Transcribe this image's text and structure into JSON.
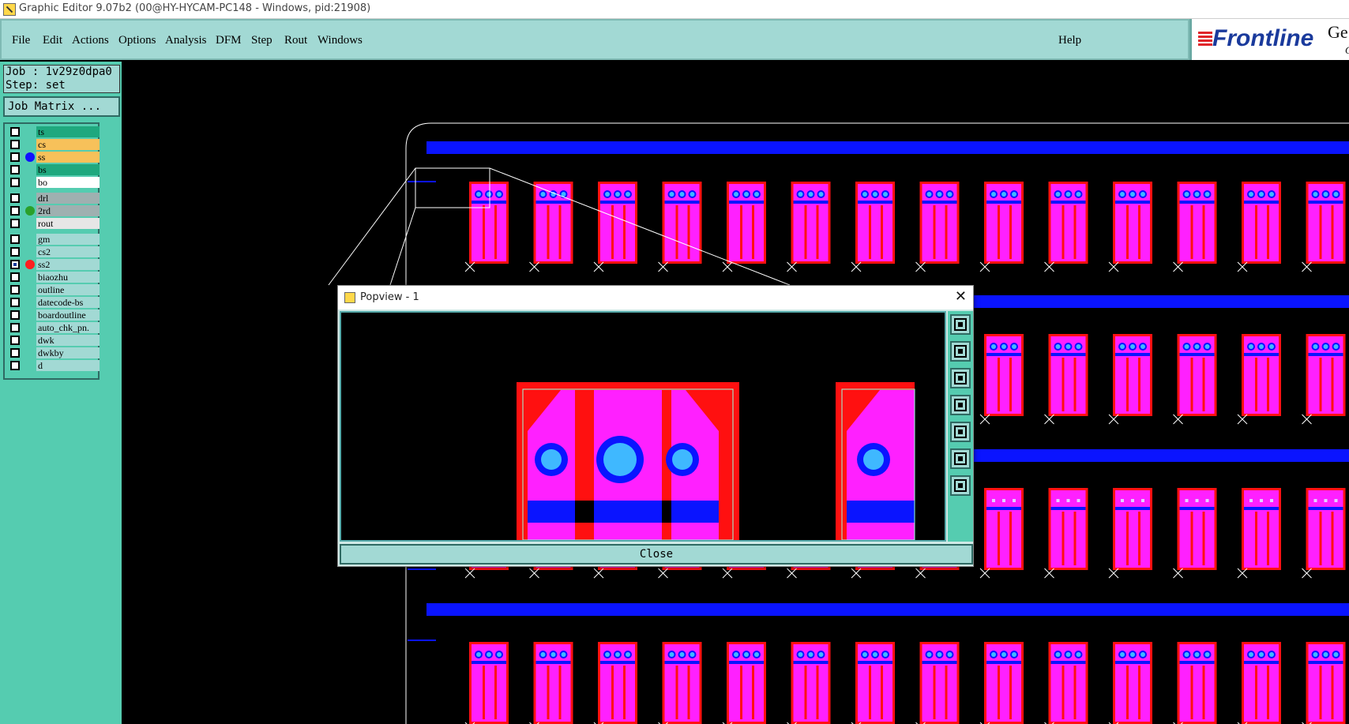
{
  "window": {
    "title": "Graphic Editor 9.07b2 (00@HY-HYCAM-PC148 - Windows, pid:21908)"
  },
  "menu": {
    "file": "File",
    "edit": "Edit",
    "actions": "Actions",
    "options": "Options",
    "analysis": "Analysis",
    "dfm": "DFM",
    "step": "Step",
    "rout": "Rout",
    "windows": "Windows",
    "help": "Help"
  },
  "logo": {
    "brand": "Frontline",
    "tail": "Ge",
    "tail2": "G"
  },
  "job": {
    "job_line": "Job : 1v29z0dpa0",
    "step_line": "Step: set"
  },
  "job_matrix_button": "Job Matrix ...",
  "layers": [
    {
      "name": "ts",
      "color": "#1fa87e",
      "checked": false,
      "dot": ""
    },
    {
      "name": "cs",
      "color": "#f7c15a",
      "checked": false,
      "dot": ""
    },
    {
      "name": "ss",
      "color": "#f7c15a",
      "checked": false,
      "dot": "#1010ff"
    },
    {
      "name": "bs",
      "color": "#1fa87e",
      "checked": false,
      "dot": ""
    },
    {
      "name": "bo",
      "color": "#ffffff",
      "checked": false,
      "dot": ""
    },
    {
      "name": "drl",
      "color": "#9fb0b0",
      "checked": false,
      "dot": ""
    },
    {
      "name": "2rd",
      "color": "#9fb0b0",
      "checked": false,
      "dot": "#2aa02a"
    },
    {
      "name": "rout",
      "color": "#e6e6e6",
      "checked": false,
      "dot": ""
    },
    {
      "name": "gm",
      "color": "#a2d9d4",
      "checked": false,
      "dot": ""
    },
    {
      "name": "cs2",
      "color": "#a2d9d4",
      "checked": false,
      "dot": ""
    },
    {
      "name": "ss2",
      "color": "#a2d9d4",
      "checked": true,
      "dot": "#ff2020"
    },
    {
      "name": "biaozhu",
      "color": "#a2d9d4",
      "checked": false,
      "dot": ""
    },
    {
      "name": "outline",
      "color": "#a2d9d4",
      "checked": false,
      "dot": ""
    },
    {
      "name": "datecode-bs",
      "color": "#a2d9d4",
      "checked": false,
      "dot": ""
    },
    {
      "name": "boardoutline",
      "color": "#a2d9d4",
      "checked": false,
      "dot": ""
    },
    {
      "name": "auto_chk_pn.",
      "color": "#a2d9d4",
      "checked": false,
      "dot": ""
    },
    {
      "name": "dwk",
      "color": "#a2d9d4",
      "checked": false,
      "dot": ""
    },
    {
      "name": "dwkby",
      "color": "#a2d9d4",
      "checked": false,
      "dot": ""
    },
    {
      "name": "d",
      "color": "#a2d9d4",
      "checked": false,
      "dot": ""
    }
  ],
  "popup": {
    "title": "Popview - 1",
    "close_label": "Close",
    "tools": [
      "zoom-window-icon",
      "pan-up-icon",
      "pan-down-icon",
      "pan-left-icon",
      "pan-right-icon",
      "zoom-home-icon",
      "zoom-fit-icon"
    ]
  },
  "colors": {
    "menubar": "#a2d9d4",
    "panel": "#55ccb0",
    "pad_magenta": "#ff20ff",
    "pad_red": "#ff1010",
    "trace_blue": "#0a14ff",
    "hole_cyan": "#3fb8ff"
  }
}
